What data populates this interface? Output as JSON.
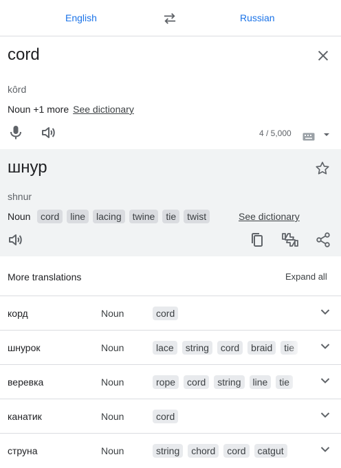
{
  "languages": {
    "source": "English",
    "target": "Russian"
  },
  "source": {
    "text": "cord",
    "transliteration": "kôrd",
    "pos_summary": "Noun +1 more",
    "see_dictionary": "See dictionary",
    "counter": "4 / 5,000"
  },
  "target": {
    "text": "шнур",
    "transliteration": "shnur",
    "pos": "Noun",
    "chips": [
      "cord",
      "line",
      "lacing",
      "twine",
      "tie",
      "twist"
    ],
    "see_dictionary": "See dictionary"
  },
  "more": {
    "title": "More translations",
    "expand_all": "Expand all",
    "rows": [
      {
        "word": "корд",
        "pos": "Noun",
        "chips": [
          "cord"
        ]
      },
      {
        "word": "шнурок",
        "pos": "Noun",
        "chips": [
          "lace",
          "string",
          "cord",
          "braid",
          "tie"
        ]
      },
      {
        "word": "веревка",
        "pos": "Noun",
        "chips": [
          "rope",
          "cord",
          "string",
          "line",
          "tie"
        ]
      },
      {
        "word": "канатик",
        "pos": "Noun",
        "chips": [
          "cord"
        ]
      },
      {
        "word": "струна",
        "pos": "Noun",
        "chips": [
          "string",
          "chord",
          "cord",
          "catgut"
        ]
      }
    ]
  },
  "icons": {
    "swap": "swap-icon",
    "close": "close-icon",
    "mic": "mic-icon",
    "speaker": "speaker-icon",
    "keyboard": "keyboard-icon",
    "star": "star-icon",
    "copy": "copy-icon",
    "feedback": "feedback-icon",
    "share": "share-icon",
    "chevron": "chevron-down-icon"
  },
  "colors": {
    "accent": "#1a73e8",
    "result_bg": "#f1f3f4",
    "chip_bg": "#dadce0"
  }
}
